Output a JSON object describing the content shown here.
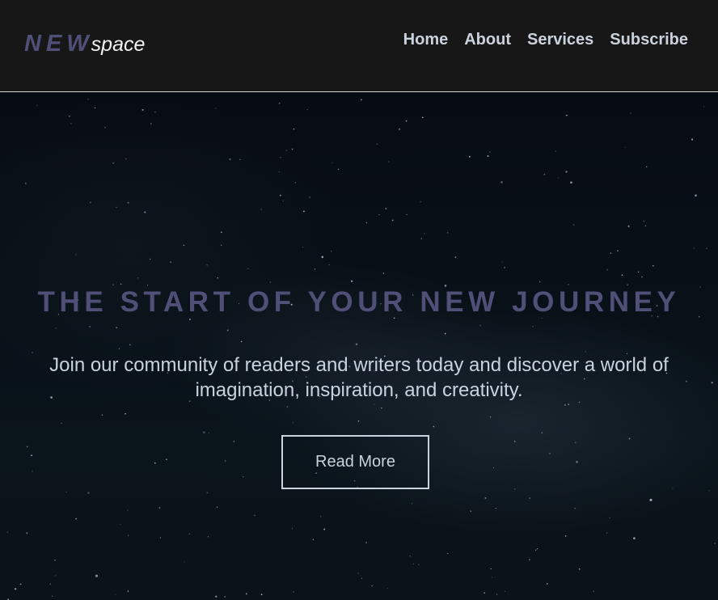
{
  "colors": {
    "accent": "#4f4f78",
    "text": "#c9d2dd",
    "header_bg": "#171717",
    "hero_bg": "#08111a"
  },
  "header": {
    "logo_strong": "NEW",
    "logo_light": "space",
    "nav": [
      {
        "label": "Home"
      },
      {
        "label": "About"
      },
      {
        "label": "Services"
      },
      {
        "label": "Subscribe"
      }
    ]
  },
  "hero": {
    "title": "THE START OF YOUR NEW JOURNEY",
    "text": "Join our community of readers and writers today and discover a world of imagination, inspiration, and creativity.",
    "button_label": "Read More"
  }
}
